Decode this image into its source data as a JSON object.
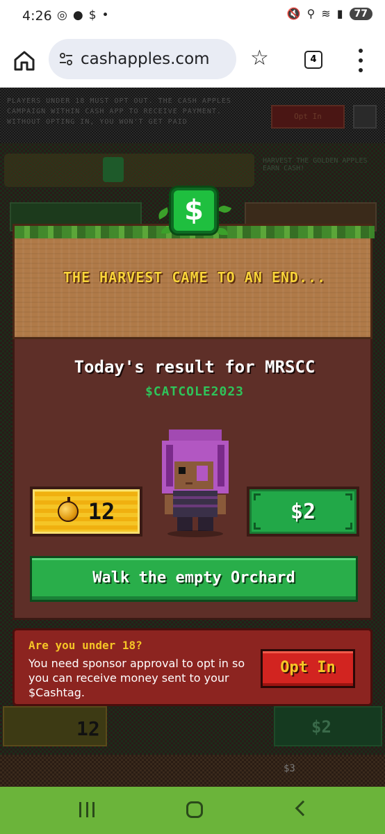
{
  "status_bar": {
    "time": "4:26",
    "left_icons": [
      "instagram-icon",
      "chat-icon",
      "dollar-icon",
      "dot-icon"
    ],
    "left_glyphs": [
      "◎",
      "●",
      "$",
      "•"
    ],
    "right_icons": [
      "mute-icon",
      "location-icon",
      "wifi-icon",
      "signal-icon"
    ],
    "right_glyphs": [
      "🔇",
      "⚲",
      "≋",
      "▮"
    ],
    "battery": "77"
  },
  "browser": {
    "url": "cashapples.com",
    "tab_count": "4"
  },
  "modal": {
    "harvest_title": "THE HARVEST CAME TO AN END...",
    "cash_badge": "$",
    "result_prefix": "Today's result for ",
    "player_name": "MRSCC",
    "cashtag": "$CATCOLE2023",
    "apples": "12",
    "money": "$2",
    "walk_button": "Walk the empty Orchard"
  },
  "notice": {
    "title": "Are you under 18?",
    "body": "You need sponsor approval to opt in so you can receive money sent to your $Cashtag.",
    "button": "Opt In"
  },
  "background": {
    "top_text": "PLAYERS UNDER 18 MUST OPT OUT. THE CASH APPLES CAMPAIGN WITHIN CASH APP TO RECEIVE PAYMENT. WITHOUT OPTING IN, YOU WON'T GET PAID",
    "top_button": "Opt In",
    "tagline": "HARVEST THE GOLDEN APPLES EARN CASH!",
    "bottom_apples": "12",
    "bottom_money": "$2",
    "strip_value": "$3"
  },
  "colors": {
    "accent_green": "#29ae4a",
    "gold": "#f5c526",
    "panel_brown": "#5e2f28",
    "notice_red": "#8c2420",
    "nav_green": "#6bb43a"
  }
}
